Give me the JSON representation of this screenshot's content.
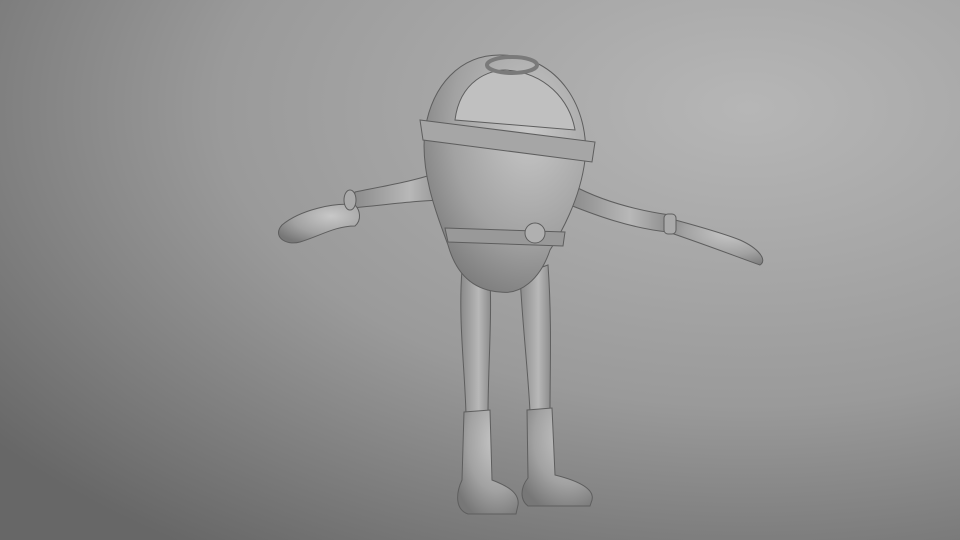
{
  "colors": {
    "background_light": "#b4b4b4",
    "background_dark": "#6a6a6a",
    "model_light": "#c6c6c6",
    "model_mid": "#9a9a9a",
    "model_dark": "#6e6e6e"
  },
  "subject": {
    "icon": "3d-character-model"
  }
}
